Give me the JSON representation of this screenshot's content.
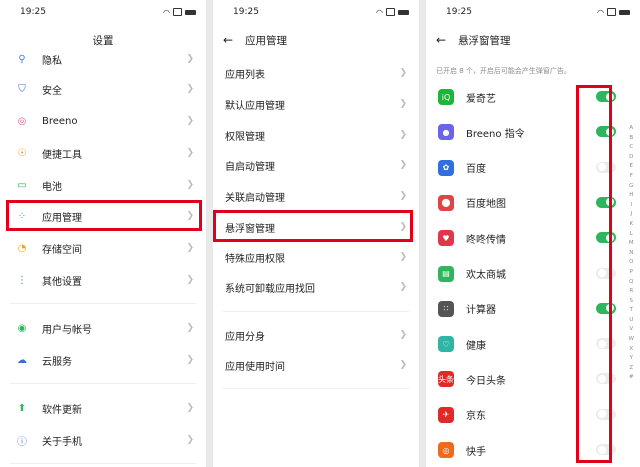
{
  "status": {
    "time": "19:25"
  },
  "panel1": {
    "title": "设置",
    "items": [
      {
        "label": "隐私",
        "icon": "privacy-icon",
        "glyph": "⚲",
        "color": "#4a7ed8"
      },
      {
        "label": "安全",
        "icon": "shield-icon",
        "glyph": "⛉",
        "color": "#3b6fd0"
      },
      {
        "label": "Breeno",
        "icon": "breeno-icon",
        "glyph": "◎",
        "color": "#e0559a"
      },
      {
        "label": "便捷工具",
        "icon": "tools-icon",
        "glyph": "☉",
        "color": "#f08a24"
      },
      {
        "label": "电池",
        "icon": "battery-icon",
        "glyph": "▭",
        "color": "#2fb55d"
      },
      {
        "label": "应用管理",
        "icon": "apps-icon",
        "glyph": "⁘",
        "color": "#2fb5a5"
      },
      {
        "label": "存储空间",
        "icon": "storage-icon",
        "glyph": "◔",
        "color": "#f0a424"
      },
      {
        "label": "其他设置",
        "icon": "other-settings-icon",
        "glyph": "⋮",
        "color": "#4a7ed8"
      },
      {
        "label": "用户与帐号",
        "icon": "user-icon",
        "glyph": "◉",
        "color": "#2fb55d"
      },
      {
        "label": "云服务",
        "icon": "cloud-icon",
        "glyph": "☁",
        "color": "#3b6fd0"
      },
      {
        "label": "软件更新",
        "icon": "update-icon",
        "glyph": "⬆",
        "color": "#2fb55d"
      },
      {
        "label": "关于手机",
        "icon": "info-icon",
        "glyph": "ⓘ",
        "color": "#4a7ed8"
      }
    ]
  },
  "panel2": {
    "title": "应用管理",
    "items": [
      {
        "label": "应用列表"
      },
      {
        "label": "默认应用管理"
      },
      {
        "label": "权限管理"
      },
      {
        "label": "自启动管理"
      },
      {
        "label": "关联启动管理"
      },
      {
        "label": "悬浮窗管理"
      },
      {
        "label": "特殊应用权限"
      },
      {
        "label": "系统可卸载应用找回"
      },
      {
        "label": "应用分身"
      },
      {
        "label": "应用使用时间"
      }
    ]
  },
  "panel3": {
    "title": "悬浮窗管理",
    "hint": "已开启 8 个，开启后可能会产生弹窗广告。",
    "apps": [
      {
        "label": "爱奇艺",
        "on": true,
        "icon": "iqiyi-icon",
        "glyph": "iQ",
        "color": "#1fb53a"
      },
      {
        "label": "Breeno 指令",
        "on": true,
        "icon": "breeno-command-icon",
        "glyph": "●",
        "color": "#6b63e8"
      },
      {
        "label": "百度",
        "on": false,
        "icon": "baidu-icon",
        "glyph": "✿",
        "color": "#2f6fe0"
      },
      {
        "label": "百度地图",
        "on": true,
        "icon": "baidu-map-icon",
        "glyph": "⬤",
        "color": "#e04444"
      },
      {
        "label": "咚咚传情",
        "on": true,
        "icon": "dongdong-icon",
        "glyph": "♥",
        "color": "#e0384a"
      },
      {
        "label": "欢太商城",
        "on": false,
        "icon": "heytap-store-icon",
        "glyph": "▤",
        "color": "#2fb55d"
      },
      {
        "label": "计算器",
        "on": true,
        "icon": "calculator-icon",
        "glyph": "∷",
        "color": "#555555"
      },
      {
        "label": "健康",
        "on": false,
        "icon": "health-icon",
        "glyph": "♡",
        "color": "#2fb5a5"
      },
      {
        "label": "今日头条",
        "on": false,
        "icon": "toutiao-icon",
        "glyph": "头条",
        "color": "#e02a2a"
      },
      {
        "label": "京东",
        "on": false,
        "icon": "jd-icon",
        "glyph": "✈",
        "color": "#e02a2a"
      },
      {
        "label": "快手",
        "on": false,
        "icon": "kuaishou-icon",
        "glyph": "◎",
        "color": "#f06a1c"
      }
    ],
    "alphabet": "A B C D E F G H I J K L M N O P Q R S T U V W X Y Z #"
  }
}
